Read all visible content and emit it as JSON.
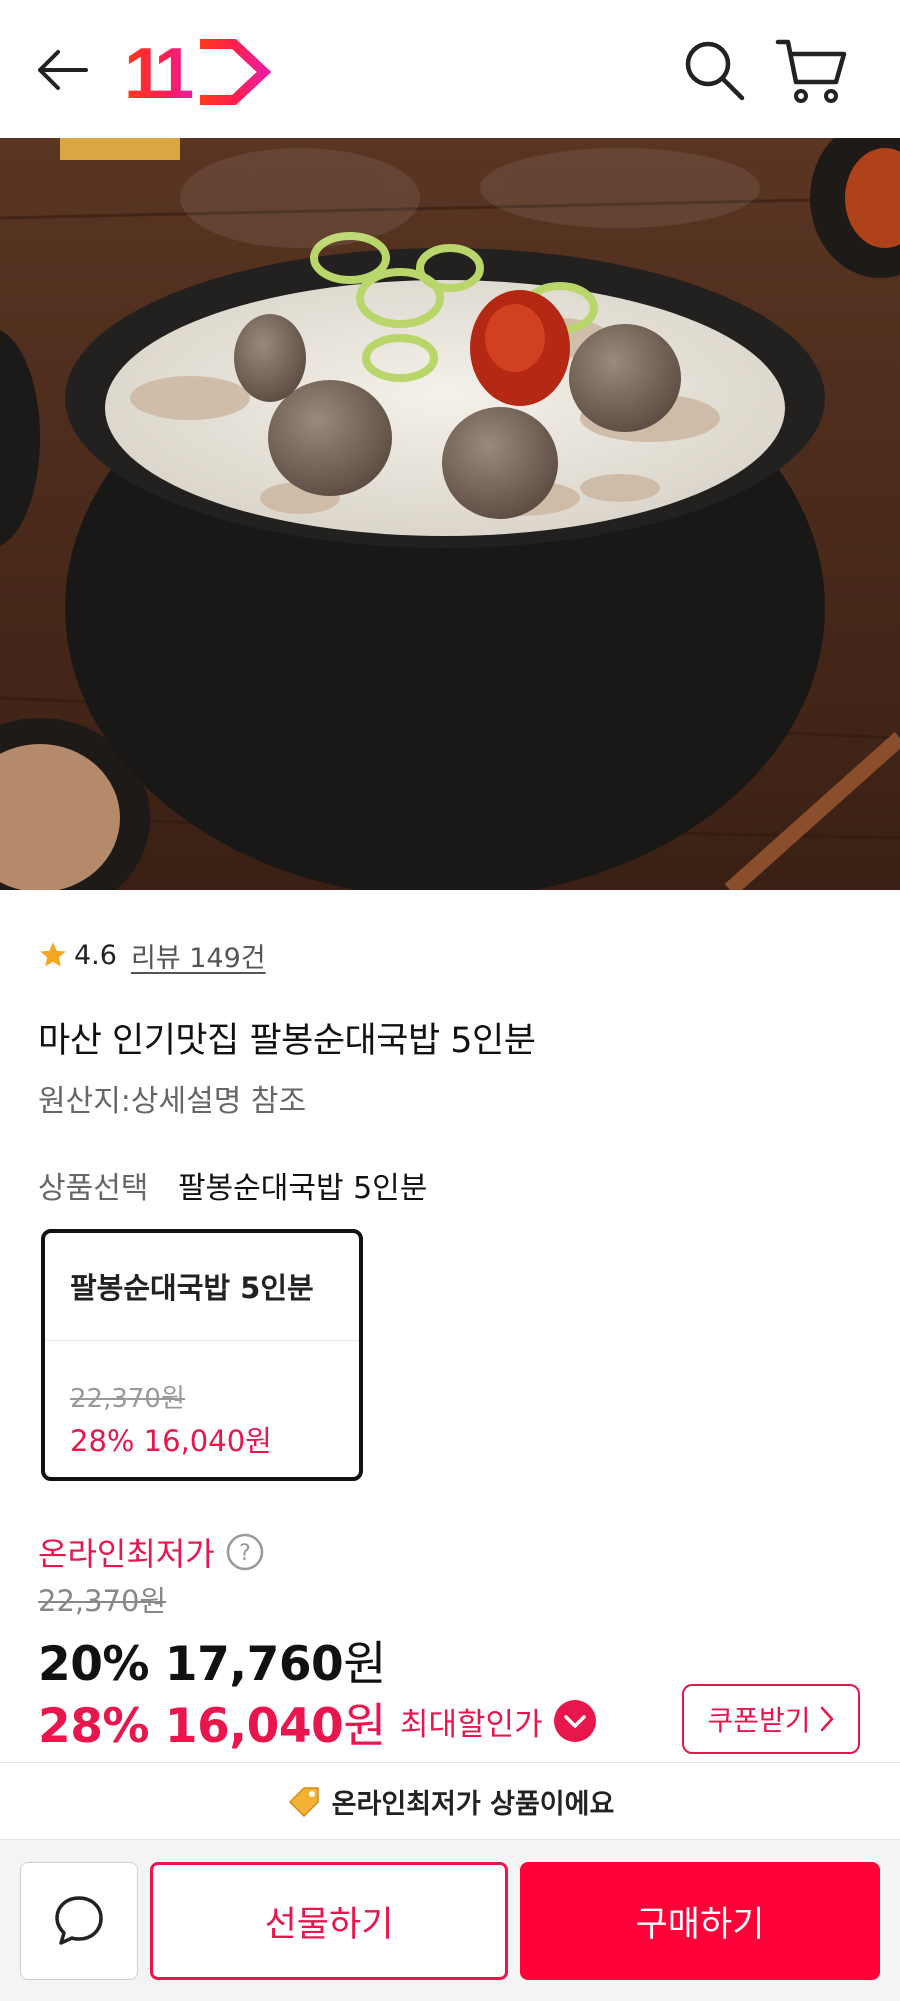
{
  "header": {
    "back_icon": "arrow-left-icon",
    "logo_text": "11",
    "search_icon": "search-icon",
    "cart_icon": "cart-icon"
  },
  "hero": {
    "image": "product-photo"
  },
  "rating": {
    "score": "4.6",
    "reviews": "리뷰 149건"
  },
  "product": {
    "title": "마산 인기맛집 팔봉순대국밥 5인분",
    "origin": "원산지:상세설명 참조"
  },
  "option": {
    "label": "상품선택",
    "selected": "팔봉순대국밥 5인분",
    "card": {
      "name": "팔봉순대국밥 5인분",
      "old_price": "22,370원",
      "discount_price": "28% 16,040원"
    }
  },
  "pricing": {
    "lowest_label": "온라인최저가",
    "old_price": "22,370원",
    "main_price_rate": "20% ",
    "main_price_amount": "17,760",
    "max_price_rate": "28% ",
    "max_price_amount": "16,040",
    "currency": "원",
    "max_label": "최대할인가",
    "coupon_label": "쿠폰받기"
  },
  "banner": {
    "text": "온라인최저가 상품이에요"
  },
  "bottom_bar": {
    "gift_label": "선물하기",
    "buy_label": "구매하기"
  },
  "colors": {
    "accent": "#e8164d",
    "buy": "#ff0038",
    "star": "#f5a623"
  }
}
